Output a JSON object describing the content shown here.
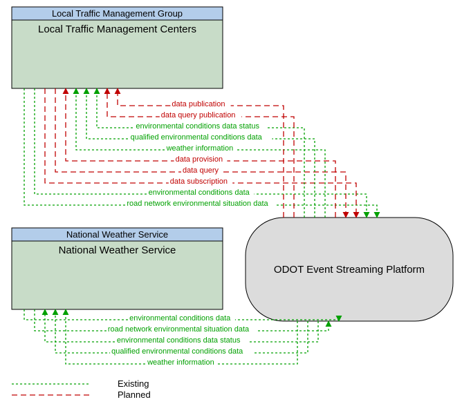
{
  "colors": {
    "existing": "#00a000",
    "planned": "#c00000",
    "box_fill": "#c8dcc8",
    "box_header_fill": "#b3cdea",
    "platform_fill": "#dcdcdc",
    "stroke": "#000000"
  },
  "boxes": {
    "top": {
      "header": "Local Traffic Management Group",
      "label": "Local Traffic Management Centers"
    },
    "bottom": {
      "header": "National Weather Service",
      "label": "National Weather Service"
    },
    "platform": {
      "label": "ODOT Event Streaming Platform"
    }
  },
  "flows_top": [
    {
      "label": "road network environmental situation data",
      "status": "existing",
      "dir": "to_platform"
    },
    {
      "label": "environmental conditions data",
      "status": "existing",
      "dir": "to_platform"
    },
    {
      "label": "data subscription",
      "status": "planned",
      "dir": "to_platform"
    },
    {
      "label": "data query",
      "status": "planned",
      "dir": "to_platform"
    },
    {
      "label": "data provision",
      "status": "planned",
      "dir": "to_box"
    },
    {
      "label": "weather information",
      "status": "existing",
      "dir": "to_box"
    },
    {
      "label": "qualified environmental conditions data",
      "status": "existing",
      "dir": "to_box"
    },
    {
      "label": "environmental conditions data status",
      "status": "existing",
      "dir": "to_box"
    },
    {
      "label": "data query publication",
      "status": "planned",
      "dir": "to_box"
    },
    {
      "label": "data publication",
      "status": "planned",
      "dir": "to_box"
    }
  ],
  "flows_bottom": [
    {
      "label": "environmental conditions data",
      "status": "existing",
      "dir": "to_platform"
    },
    {
      "label": "road network environmental situation data",
      "status": "existing",
      "dir": "to_platform"
    },
    {
      "label": "environmental conditions data status",
      "status": "existing",
      "dir": "to_box"
    },
    {
      "label": "qualified environmental conditions data",
      "status": "existing",
      "dir": "to_box"
    },
    {
      "label": "weather information",
      "status": "existing",
      "dir": "to_box"
    }
  ],
  "legend": {
    "existing": "Existing",
    "planned": "Planned"
  }
}
